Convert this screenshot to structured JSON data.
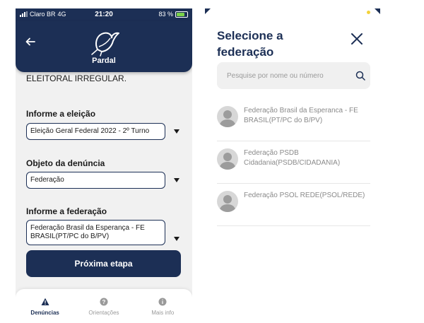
{
  "status_bar": {
    "carrier": "Claro BR",
    "network": "4G",
    "time": "21:20",
    "battery": "83 %"
  },
  "header": {
    "logo_text": "Pardal",
    "back_icon": "arrow-left-icon"
  },
  "form": {
    "intro_text": "a sua denúncia de PROPAGANDA ELEITORAL IRREGULAR.",
    "election_label": "Informe a eleição",
    "election_value": "Eleição Geral Federal 2022 - 2º Turno",
    "object_label": "Objeto da denúncia",
    "object_value": "Federação",
    "federation_label": "Informe a federação",
    "federation_value": "Federação Brasil da Esperança - FE BRASIL(PT/PC do B/PV)",
    "next_button": "Próxima etapa"
  },
  "tabbar": {
    "tabs": [
      {
        "label": "Denúncias",
        "icon": "warning-icon",
        "active": true
      },
      {
        "label": "Orientações",
        "icon": "help-icon",
        "active": false
      },
      {
        "label": "Mais info",
        "icon": "info-icon",
        "active": false
      }
    ]
  },
  "modal": {
    "title": "Selecione a federação",
    "close_icon": "close-icon",
    "search_placeholder": "Pesquise por nome ou número",
    "federations": [
      {
        "name": "Federação Brasil da Esperanca - FE BRASIL(PT/PC do B/PV)"
      },
      {
        "name": "Federação PSDB Cidadania(PSDB/CIDADANIA)"
      },
      {
        "name": "Federação PSOL REDE(PSOL/REDE)"
      }
    ]
  },
  "colors": {
    "primary": "#1c2f55",
    "background": "#f1f1f1",
    "battery": "#7bd24a"
  }
}
